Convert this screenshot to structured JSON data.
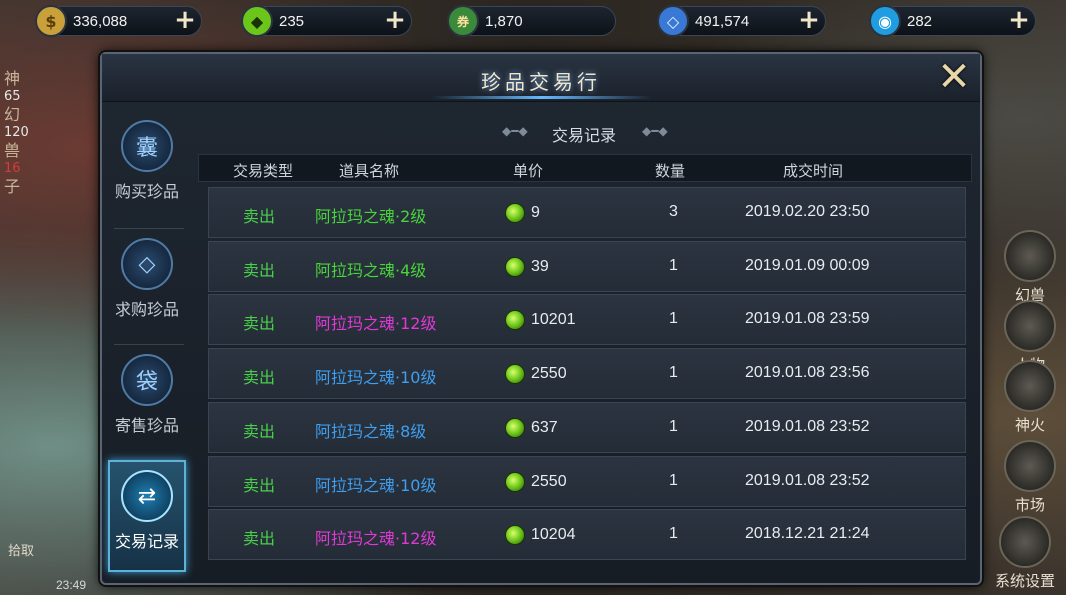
{
  "currencies": [
    {
      "icon": "gold-coin-icon",
      "value": "336,088",
      "color": "#c9a03a",
      "glyph": "$"
    },
    {
      "icon": "green-gem-icon",
      "value": "235",
      "color": "#6cc51a",
      "glyph": "◆"
    },
    {
      "icon": "red-ticket-icon",
      "value": "1,870",
      "color": "#c0392b",
      "glyph": "券"
    },
    {
      "icon": "blue-crystal-icon",
      "value": "491,574",
      "color": "#3a78d6",
      "glyph": "◇"
    },
    {
      "icon": "blue-orb-icon",
      "value": "282",
      "color": "#1f9de0",
      "glyph": "◉"
    }
  ],
  "scene_left": {
    "level": "65",
    "num2": "120",
    "num3": "16",
    "t1": "神",
    "t2": "幻",
    "t3": "兽",
    "t4": "子"
  },
  "right_menu": [
    "幻兽",
    "人物",
    "神火",
    "市场",
    "系统设置"
  ],
  "panel": {
    "title": "珍品交易行",
    "close": "✕",
    "section_title": "交易记录",
    "orn_left": "◆━◆",
    "orn_right": "◆━◆"
  },
  "tabs": [
    {
      "label": "购买珍品",
      "icon": "money-bag-icon",
      "glyph": "囊",
      "active": false
    },
    {
      "label": "求购珍品",
      "icon": "diamond-hand-icon",
      "glyph": "◇",
      "active": false
    },
    {
      "label": "寄售珍品",
      "icon": "sell-bag-icon",
      "glyph": "袋",
      "active": false
    },
    {
      "label": "交易记录",
      "icon": "shuffle-icon",
      "glyph": "⇄",
      "active": true
    }
  ],
  "table": {
    "headers": [
      "交易类型",
      "道具名称",
      "单价",
      "数量",
      "成交时间"
    ],
    "rows": [
      {
        "type": "卖出",
        "name": "阿拉玛之魂·2级",
        "name_color": "#49d43c",
        "price": "9",
        "qty": "3",
        "time": "2019.02.20 23:50"
      },
      {
        "type": "卖出",
        "name": "阿拉玛之魂·4级",
        "name_color": "#49d43c",
        "price": "39",
        "qty": "1",
        "time": "2019.01.09 00:09"
      },
      {
        "type": "卖出",
        "name": "阿拉玛之魂·12级",
        "name_color": "#e03ad6",
        "price": "10201",
        "qty": "1",
        "time": "2019.01.08 23:59"
      },
      {
        "type": "卖出",
        "name": "阿拉玛之魂·10级",
        "name_color": "#3e9ef0",
        "price": "2550",
        "qty": "1",
        "time": "2019.01.08 23:56"
      },
      {
        "type": "卖出",
        "name": "阿拉玛之魂·8级",
        "name_color": "#3e9ef0",
        "price": "637",
        "qty": "1",
        "time": "2019.01.08 23:52"
      },
      {
        "type": "卖出",
        "name": "阿拉玛之魂·10级",
        "name_color": "#3e9ef0",
        "price": "2550",
        "qty": "1",
        "time": "2019.01.08 23:52"
      },
      {
        "type": "卖出",
        "name": "阿拉玛之魂·12级",
        "name_color": "#e03ad6",
        "price": "10204",
        "qty": "1",
        "time": "2018.12.21 21:24"
      }
    ]
  },
  "bottom": {
    "pickup": "拾取",
    "clock": "23:49"
  }
}
